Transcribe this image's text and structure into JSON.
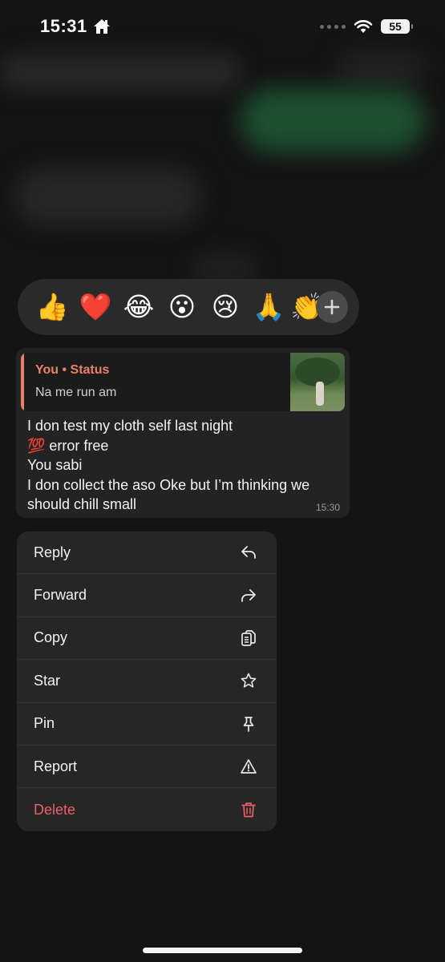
{
  "status_bar": {
    "time": "15:31",
    "battery": "55"
  },
  "reactions": {
    "items": [
      "👍",
      "❤️",
      "😂",
      "😮",
      "😢",
      "🙏",
      "👏"
    ]
  },
  "message": {
    "quote": {
      "title": "You • Status",
      "body": "Na me run am"
    },
    "lines": [
      "I don test my cloth self last night",
      "💯 error free",
      "You sabi",
      "I don collect the aso Oke but I’m thinking we should chill small"
    ],
    "time": "15:30"
  },
  "menu": {
    "items": [
      {
        "label": "Reply",
        "icon": "reply-icon"
      },
      {
        "label": "Forward",
        "icon": "forward-icon"
      },
      {
        "label": "Copy",
        "icon": "copy-icon"
      },
      {
        "label": "Star",
        "icon": "star-icon"
      },
      {
        "label": "Pin",
        "icon": "pin-icon"
      },
      {
        "label": "Report",
        "icon": "warning-icon"
      },
      {
        "label": "Delete",
        "icon": "trash-icon"
      }
    ]
  },
  "colors": {
    "accent_quote": "#e9806a",
    "danger": "#e8606a"
  }
}
